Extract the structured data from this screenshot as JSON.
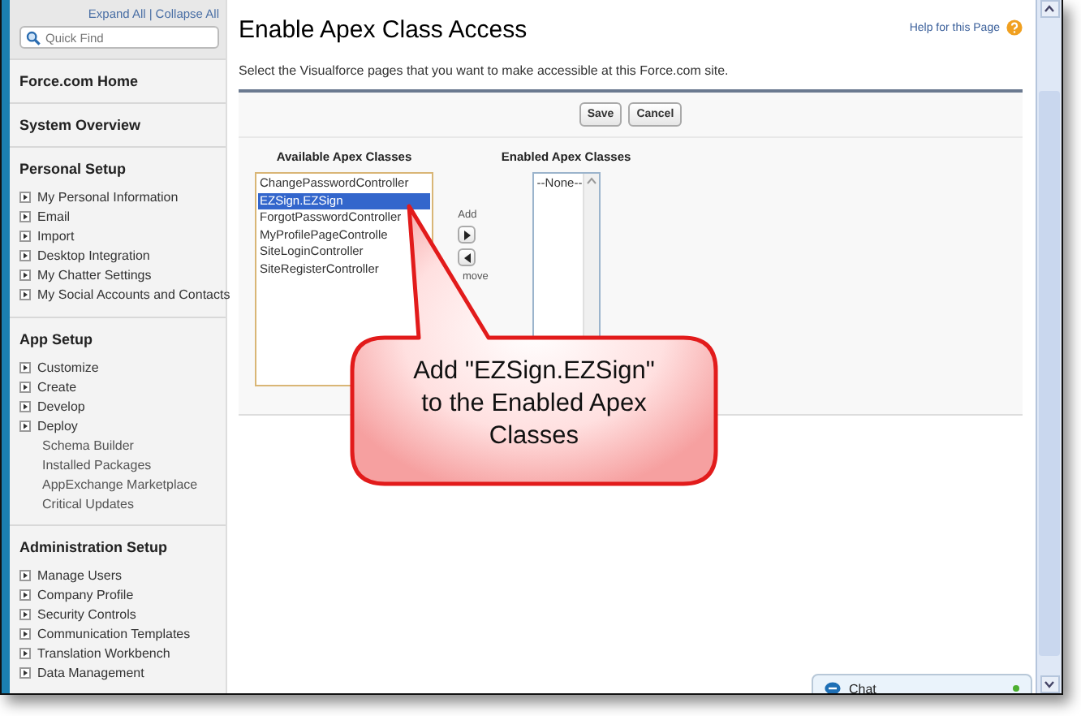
{
  "sidebar": {
    "links": [
      "Expand All",
      "|",
      "Collapse All"
    ],
    "search": {
      "placeholder": "Quick Find"
    },
    "sections": [
      {
        "title": "Force.com Home"
      },
      {
        "title": "System Overview"
      },
      {
        "title": "Personal Setup",
        "items": [
          {
            "label": "My Personal Information",
            "kind": "expandable"
          },
          {
            "label": "Email",
            "kind": "expandable"
          },
          {
            "label": "Import",
            "kind": "expandable"
          },
          {
            "label": "Desktop Integration",
            "kind": "expandable"
          },
          {
            "label": "My Chatter Settings",
            "kind": "expandable"
          },
          {
            "label": "My Social Accounts and Contacts",
            "kind": "expandable"
          }
        ]
      },
      {
        "title": "App Setup",
        "items": [
          {
            "label": "Customize",
            "kind": "expandable"
          },
          {
            "label": "Create",
            "kind": "expandable"
          },
          {
            "label": "Develop",
            "kind": "expandable"
          },
          {
            "label": "Deploy",
            "kind": "expandable"
          },
          {
            "label": "Schema Builder",
            "kind": "link"
          },
          {
            "label": "Installed Packages",
            "kind": "link"
          },
          {
            "label": "AppExchange Marketplace",
            "kind": "link"
          },
          {
            "label": "Critical Updates",
            "kind": "link"
          }
        ]
      },
      {
        "title": "Administration Setup",
        "items": [
          {
            "label": "Manage Users",
            "kind": "expandable"
          },
          {
            "label": "Company Profile",
            "kind": "expandable"
          },
          {
            "label": "Security Controls",
            "kind": "expandable"
          },
          {
            "label": "Communication Templates",
            "kind": "expandable"
          },
          {
            "label": "Translation Workbench",
            "kind": "expandable"
          },
          {
            "label": "Data Management",
            "kind": "expandable"
          }
        ]
      }
    ]
  },
  "page": {
    "title": "Enable Apex Class Access",
    "help": "Help for this Page",
    "description": "Select the Visualforce pages that you want to make accessible at this Force.com site.",
    "buttons": [
      "Save",
      "Cancel"
    ],
    "available": {
      "heading": "Available Apex Classes",
      "items": [
        {
          "label": "ChangePasswordController",
          "selected": false
        },
        {
          "label": "EZSign.EZSign",
          "selected": true
        },
        {
          "label": "ForgotPasswordController",
          "selected": false
        },
        {
          "label": "MyProfilePageControlle",
          "selected": false
        },
        {
          "label": "SiteLoginController",
          "selected": false
        },
        {
          "label": "SiteRegisterController",
          "selected": false
        }
      ]
    },
    "add_label": "Add",
    "remove_label": "move",
    "enabled": {
      "heading": "Enabled Apex Classes",
      "items": [
        {
          "label": "--None--",
          "selected": false
        }
      ]
    }
  },
  "callout": {
    "text": "Add \"EZSign.EZSign\" to the Enabled Apex Classes"
  },
  "chat": {
    "label": "Chat",
    "online": true
  }
}
